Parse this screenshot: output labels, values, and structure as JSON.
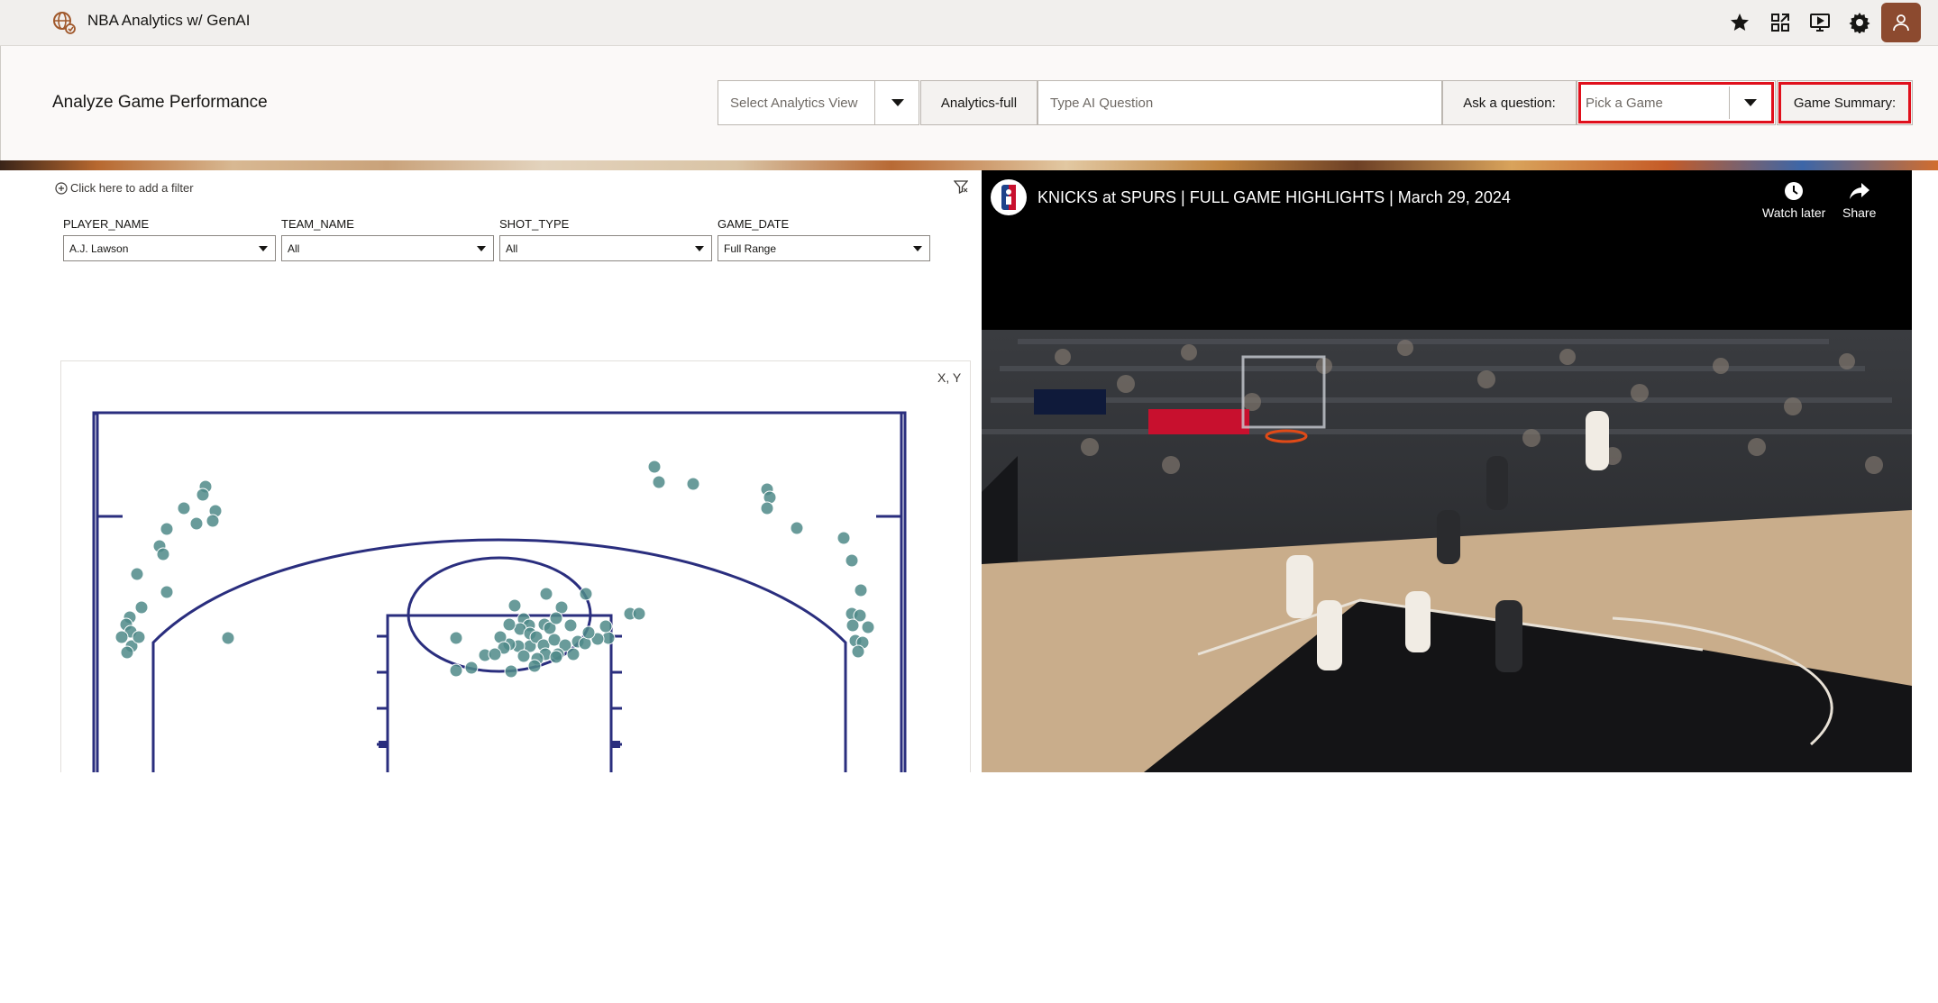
{
  "app": {
    "title": "NBA Analytics w/ GenAI",
    "logo_icon": "globe-app-icon",
    "header_icons": [
      "star-icon",
      "share-network-icon",
      "present-icon",
      "gear-icon",
      "user-icon"
    ]
  },
  "header": {
    "page_title": "Analyze Game Performance",
    "analytics_view_placeholder": "Select Analytics View",
    "analytics_full_button": "Analytics-full",
    "ai_question_placeholder": "Type AI Question",
    "ask_button": "Ask a question:",
    "pick_game_placeholder": "Pick a Game",
    "game_summary_button": "Game Summary:",
    "highlight_color": "#e0101c"
  },
  "filters": {
    "add_filter_text": "Click here to add a filter",
    "prompts": [
      {
        "label": "PLAYER_NAME",
        "value": "A.J. Lawson"
      },
      {
        "label": "TEAM_NAME",
        "value": "All"
      },
      {
        "label": "SHOT_TYPE",
        "value": "All"
      },
      {
        "label": "GAME_DATE",
        "value": "Full Range"
      }
    ]
  },
  "chart": {
    "axis_label": "X, Y",
    "court_color": "#2a2e7e",
    "point_color": "#4f8a88"
  },
  "video": {
    "title": "KNICKS at SPURS | FULL GAME HIGHLIGHTS | March 29, 2024",
    "watch_later": "Watch later",
    "share": "Share"
  }
}
